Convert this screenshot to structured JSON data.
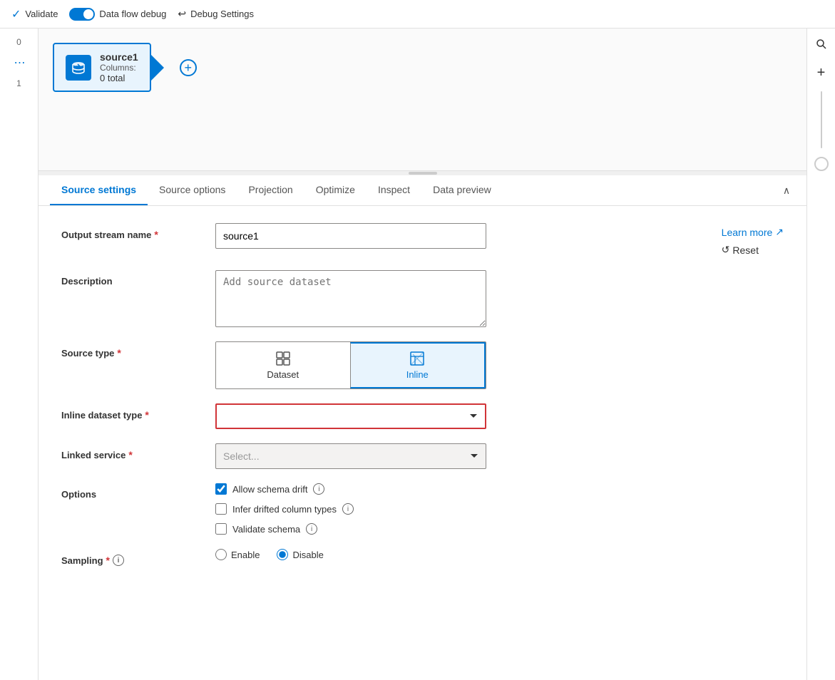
{
  "topbar": {
    "validate_label": "Validate",
    "dataflow_debug_label": "Data flow debug",
    "debug_settings_label": "Debug Settings"
  },
  "canvas": {
    "node_title": "source1",
    "node_columns_label": "Columns:",
    "node_count": "0 total",
    "add_btn_label": "+"
  },
  "tabs": [
    {
      "id": "source-settings",
      "label": "Source settings",
      "active": true
    },
    {
      "id": "source-options",
      "label": "Source options",
      "active": false
    },
    {
      "id": "projection",
      "label": "Projection",
      "active": false
    },
    {
      "id": "optimize",
      "label": "Optimize",
      "active": false
    },
    {
      "id": "inspect",
      "label": "Inspect",
      "active": false
    },
    {
      "id": "data-preview",
      "label": "Data preview",
      "active": false
    }
  ],
  "form": {
    "output_stream_name_label": "Output stream name",
    "output_stream_name_value": "source1",
    "description_label": "Description",
    "description_placeholder": "Add source dataset",
    "source_type_label": "Source type",
    "source_type_dataset_label": "Dataset",
    "source_type_inline_label": "Inline",
    "inline_dataset_type_label": "Inline dataset type",
    "inline_dataset_type_placeholder": "",
    "linked_service_label": "Linked service",
    "linked_service_placeholder": "Select...",
    "options_label": "Options",
    "allow_schema_drift_label": "Allow schema drift",
    "infer_drifted_label": "Infer drifted column types",
    "validate_schema_label": "Validate schema",
    "sampling_label": "Sampling",
    "sampling_enable_label": "Enable",
    "sampling_disable_label": "Disable",
    "learn_more_label": "Learn more",
    "reset_label": "Reset"
  },
  "sidebar_left": {
    "num1": "0",
    "num2": "1",
    "dots": "⋯"
  },
  "icons": {
    "search": "🔍",
    "plus": "+",
    "chevron_up": "∧",
    "info": "i",
    "external_link": "↗",
    "reset_circle": "↺",
    "database": "🗄",
    "chevron_down": "∨",
    "validate_check": "✓"
  },
  "colors": {
    "brand": "#0078d4",
    "required": "#d13438",
    "active_bg": "#e8f4fd"
  }
}
